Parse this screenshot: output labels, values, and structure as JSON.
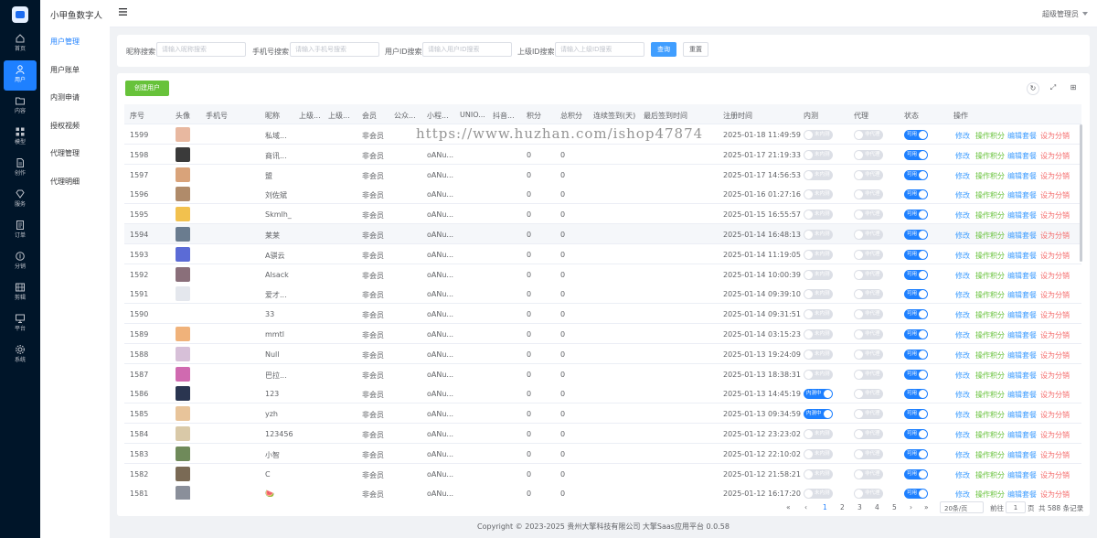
{
  "app": {
    "brand": "小甲鱼数字人",
    "admin_label": "超级管理员"
  },
  "rail": [
    {
      "label": "首页",
      "icon": "home-icon"
    },
    {
      "label": "用户",
      "icon": "user-icon",
      "active": true
    },
    {
      "label": "内容",
      "icon": "folder-icon"
    },
    {
      "label": "模型",
      "icon": "grid-icon"
    },
    {
      "label": "创作",
      "icon": "file-icon"
    },
    {
      "label": "服务",
      "icon": "diamond-icon"
    },
    {
      "label": "订单",
      "icon": "order-icon"
    },
    {
      "label": "分销",
      "icon": "coin-icon"
    },
    {
      "label": "剪辑",
      "icon": "film-icon"
    },
    {
      "label": "平台",
      "icon": "monitor-icon"
    },
    {
      "label": "系统",
      "icon": "gear-icon"
    }
  ],
  "submenu": [
    {
      "label": "用户管理",
      "active": true
    },
    {
      "label": "用户账单"
    },
    {
      "label": "内测申请"
    },
    {
      "label": "授权视频"
    },
    {
      "label": "代理管理"
    },
    {
      "label": "代理明细"
    }
  ],
  "search": {
    "nickname_label": "昵称搜索",
    "nickname_ph": "请输入昵称搜索",
    "phone_label": "手机号搜索",
    "phone_ph": "请输入手机号搜索",
    "uid_label": "用户ID搜索",
    "uid_ph": "请输入用户ID搜索",
    "parent_label": "上级ID搜索",
    "parent_ph": "请输入上级ID搜索",
    "query_btn": "查询",
    "reset_btn": "重置"
  },
  "toolbar": {
    "create_btn": "创建用户",
    "refresh_icon": "refresh-icon",
    "fullscreen_icon": "fullscreen-icon",
    "settings_icon": "settings-icon"
  },
  "table": {
    "columns": [
      "序号",
      "头像",
      "手机号",
      "昵称",
      "上级...",
      "上级...",
      "会员",
      "公众...",
      "小程...",
      "UNIO...",
      "抖音...",
      "积分",
      "总积分",
      "连续签到(天)",
      "最后签到时间",
      "注册时间",
      "内测",
      "代理",
      "状态",
      "操作"
    ],
    "switch_text": {
      "beta_on": "内测中",
      "beta_off": "未内测",
      "agent_off": "非代理",
      "status_on": "可用"
    },
    "actions": {
      "edit": "修改",
      "points": "操作积分",
      "package": "编辑套餐",
      "dist": "设为分销"
    },
    "rows": [
      {
        "id": "1599",
        "nick": "私域...",
        "member": "非会员",
        "mini": "",
        "points": "",
        "total": "",
        "reg": "2025-01-18 11:49:59",
        "beta": false,
        "avatar": "#e8b8a0"
      },
      {
        "id": "1598",
        "nick": "商讯...",
        "member": "非会员",
        "mini": "oANu...",
        "points": "0",
        "total": "0",
        "reg": "2025-01-17 21:19:33",
        "beta": false,
        "avatar": "#3a3a3a"
      },
      {
        "id": "1597",
        "nick": "盟",
        "member": "非会员",
        "mini": "oANu...",
        "points": "0",
        "total": "0",
        "reg": "2025-01-17 14:56:53",
        "beta": false,
        "avatar": "#d9a37a"
      },
      {
        "id": "1596",
        "nick": "刘佐斌",
        "member": "非会员",
        "mini": "oANu...",
        "points": "0",
        "total": "0",
        "reg": "2025-01-16 01:27:16",
        "beta": false,
        "avatar": "#b08b6a"
      },
      {
        "id": "1595",
        "nick": "Skmlh_",
        "member": "非会员",
        "mini": "oANu...",
        "points": "0",
        "total": "0",
        "reg": "2025-01-15 16:55:57",
        "beta": false,
        "avatar": "#f2c14e"
      },
      {
        "id": "1594",
        "nick": "莱莱",
        "member": "非会员",
        "mini": "oANu...",
        "points": "0",
        "total": "0",
        "reg": "2025-01-14 16:48:13",
        "beta": false,
        "avatar": "#6a7c8f",
        "highlight": true
      },
      {
        "id": "1593",
        "nick": "A骐云",
        "member": "非会员",
        "mini": "oANu...",
        "points": "0",
        "total": "0",
        "reg": "2025-01-14 11:19:05",
        "beta": false,
        "avatar": "#5b6bd6"
      },
      {
        "id": "1592",
        "nick": "Alsack",
        "member": "非会员",
        "mini": "oANu...",
        "points": "0",
        "total": "0",
        "reg": "2025-01-14 10:00:39",
        "beta": false,
        "avatar": "#8a6f7a"
      },
      {
        "id": "1591",
        "nick": "爱才...",
        "member": "非会员",
        "mini": "oANu...",
        "points": "0",
        "total": "0",
        "reg": "2025-01-14 09:39:10",
        "beta": false,
        "avatar": "#e4e7ed"
      },
      {
        "id": "1590",
        "nick": "33",
        "member": "非会员",
        "mini": "oANu...",
        "points": "0",
        "total": "0",
        "reg": "2025-01-14 09:31:51",
        "beta": false,
        "avatar": "#ffffff"
      },
      {
        "id": "1589",
        "nick": "mmtl",
        "member": "非会员",
        "mini": "oANu...",
        "points": "0",
        "total": "0",
        "reg": "2025-01-14 03:15:23",
        "beta": false,
        "avatar": "#f0b27a"
      },
      {
        "id": "1588",
        "nick": "Null",
        "member": "非会员",
        "mini": "oANu...",
        "points": "0",
        "total": "0",
        "reg": "2025-01-13 19:24:09",
        "beta": false,
        "avatar": "#d7c0d8"
      },
      {
        "id": "1587",
        "nick": "巴拉...",
        "member": "非会员",
        "mini": "oANu...",
        "points": "0",
        "total": "0",
        "reg": "2025-01-13 18:38:31",
        "beta": false,
        "avatar": "#d06ab0"
      },
      {
        "id": "1586",
        "nick": "123",
        "member": "非会员",
        "mini": "oANu...",
        "points": "0",
        "total": "0",
        "reg": "2025-01-13 14:45:19",
        "beta": true,
        "avatar": "#2a3550"
      },
      {
        "id": "1585",
        "nick": "yzh",
        "member": "非会员",
        "mini": "oANu...",
        "points": "0",
        "total": "0",
        "reg": "2025-01-13 09:34:59",
        "beta": true,
        "avatar": "#e8c49a"
      },
      {
        "id": "1584",
        "nick": "123456",
        "member": "非会员",
        "mini": "oANu...",
        "points": "0",
        "total": "0",
        "reg": "2025-01-12 23:23:02",
        "beta": false,
        "avatar": "#d9c9a8"
      },
      {
        "id": "1583",
        "nick": "小智",
        "member": "非会员",
        "mini": "oANu...",
        "points": "0",
        "total": "0",
        "reg": "2025-01-12 22:10:02",
        "beta": false,
        "avatar": "#6f8a5a"
      },
      {
        "id": "1582",
        "nick": "C",
        "member": "非会员",
        "mini": "oANu...",
        "points": "0",
        "total": "0",
        "reg": "2025-01-12 21:58:21",
        "beta": false,
        "avatar": "#7a6a55"
      },
      {
        "id": "1581",
        "nick": "🍉",
        "member": "非会员",
        "mini": "oANu...",
        "points": "0",
        "total": "0",
        "reg": "2025-01-12 16:17:20",
        "beta": false,
        "avatar": "#8a8f9a"
      }
    ]
  },
  "pagination": {
    "pages": [
      "1",
      "2",
      "3",
      "4",
      "5"
    ],
    "current": "1",
    "page_size": "20条/页",
    "goto_label": "前往",
    "goto_value": "1",
    "page_suffix": "页",
    "total": "共 588 条记录"
  },
  "footer": "Copyright © 2023-2025 贵州大擎科技有限公司  大擎Saas应用平台 0.0.58",
  "watermark": "https://www.huzhan.com/ishop47874"
}
